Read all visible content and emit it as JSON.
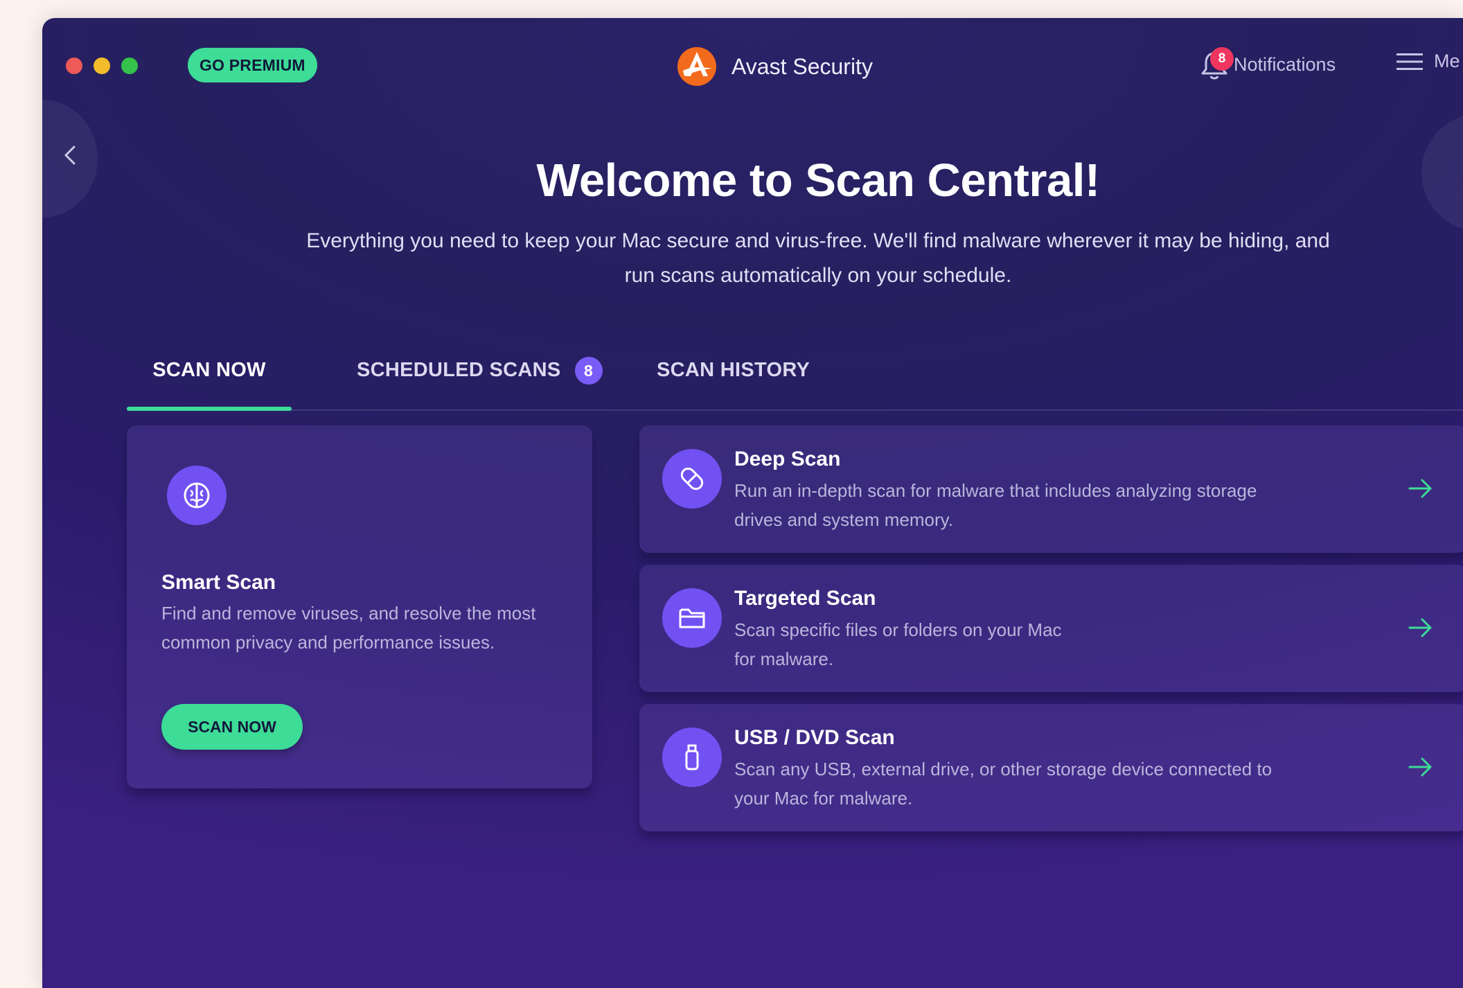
{
  "titlebar": {
    "premium_label": "GO PREMIUM",
    "app_title": "Avast Security",
    "notifications_label": "Notifications",
    "notifications_count": "8",
    "menu_label": "Me"
  },
  "hero": {
    "title": "Welcome to Scan Central!",
    "subtitle_line1": "Everything you need to keep your Mac secure and virus-free. We'll find malware wherever it may be hiding, and",
    "subtitle_line2": "run scans automatically on your schedule."
  },
  "tabs": [
    {
      "label": "SCAN NOW",
      "active": true
    },
    {
      "label": "SCHEDULED SCANS",
      "badge": "8"
    },
    {
      "label": "SCAN HISTORY"
    }
  ],
  "smart_scan": {
    "title": "Smart Scan",
    "description": "Find and remove viruses, and resolve the most common privacy and performance issues.",
    "button": "SCAN NOW"
  },
  "scans": [
    {
      "title": "Deep Scan",
      "line1": "Run an in-depth scan for malware that includes analyzing storage",
      "line2": "drives and system memory.",
      "icon": "bandage-icon"
    },
    {
      "title": "Targeted Scan",
      "line1": "Scan specific files or folders on your Mac",
      "line2": "for malware.",
      "icon": "folder-icon"
    },
    {
      "title": "USB / DVD Scan",
      "line1": "Scan any USB, external drive, or other storage device connected to",
      "line2": "your Mac for malware.",
      "icon": "usb-icon"
    }
  ],
  "colors": {
    "accent_green": "#3ddc97",
    "accent_purple": "#7251f3",
    "badge_red": "#f0365f"
  }
}
